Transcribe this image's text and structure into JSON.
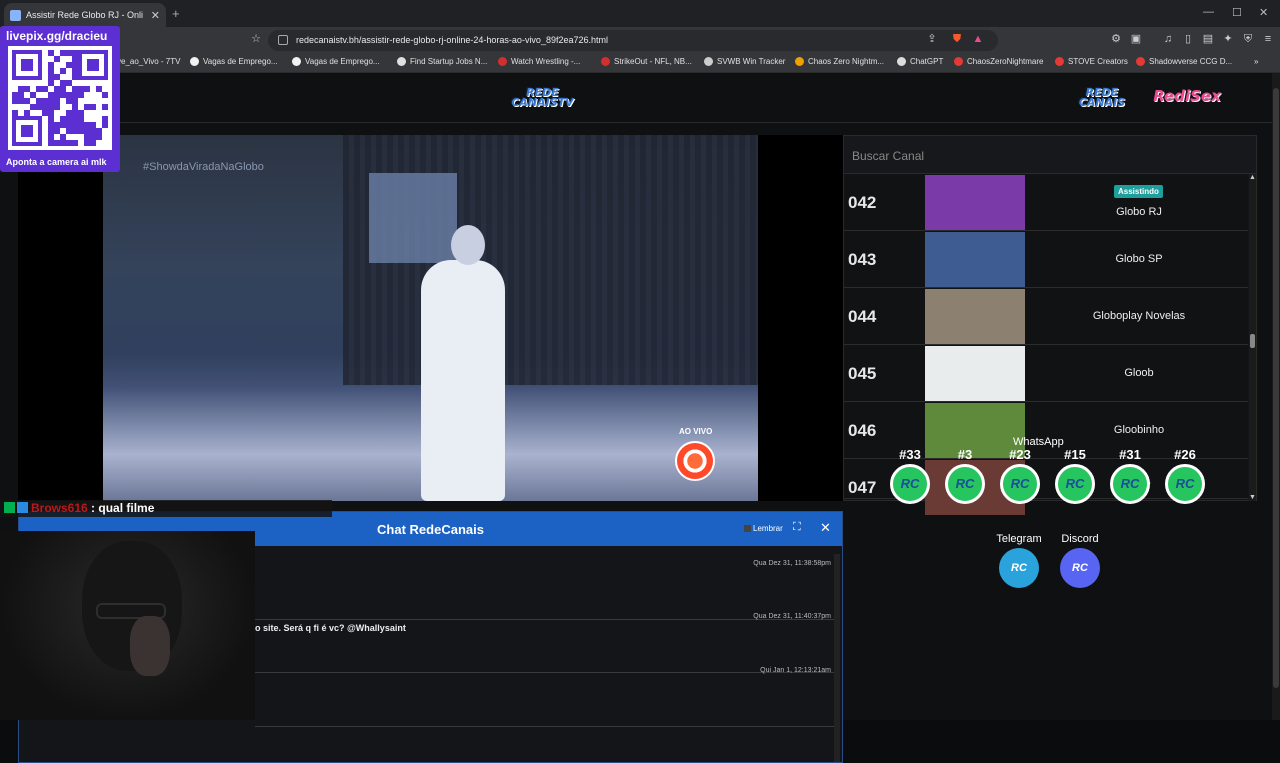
{
  "browser": {
    "tab_title": "Assistir Rede Globo RJ - Onli",
    "url": "redecanaistv.bh/assistir-rede-globo-rj-online-24-horas-ao-vivo_89f2ea726.html",
    "new_tab": "+",
    "bookmarks": [
      {
        "label": "ve_ao_Vivo - 7TV",
        "color": "#888888"
      },
      {
        "label": "Vagas de Emprego...",
        "color": "#f2f2f2"
      },
      {
        "label": "Vagas de Emprego...",
        "color": "#f2f2f2"
      },
      {
        "label": "Find Startup Jobs N...",
        "color": "#e0e0e0"
      },
      {
        "label": "Watch Wrestling -...",
        "color": "#d32f2f"
      },
      {
        "label": "StrikeOut - NFL, NB...",
        "color": "#d32f2f"
      },
      {
        "label": "SVWB Win Tracker",
        "color": "#cccccc"
      },
      {
        "label": "Chaos Zero Nightm...",
        "color": "#f0a000"
      },
      {
        "label": "ChatGPT",
        "color": "#dddddd"
      },
      {
        "label": "ChaosZeroNightmare",
        "color": "#e53935"
      },
      {
        "label": "STOVE Creators",
        "color": "#e53935"
      },
      {
        "label": "Shadowverse CCG D...",
        "color": "#e53935"
      }
    ]
  },
  "site": {
    "logo_main_line1": "REDE",
    "logo_main_line2": "CANAISTV",
    "logo_right1_line1": "REDE",
    "logo_right1_line2": "CANAIS",
    "logo_right2": "RediSex"
  },
  "player": {
    "hashtag": "#ShowdaViradaNaGlobo",
    "live_label": "AO VIVO"
  },
  "channels": {
    "search_placeholder": "Buscar Canal",
    "items": [
      {
        "number": "042",
        "name": "Globo RJ",
        "badge": "Assistindo",
        "thumb": "#7a3aa8"
      },
      {
        "number": "043",
        "name": "Globo SP",
        "badge": "",
        "thumb": "#3f5c92"
      },
      {
        "number": "044",
        "name": "Globoplay Novelas",
        "badge": "",
        "thumb": "#8c8170"
      },
      {
        "number": "045",
        "name": "Gloob",
        "badge": "",
        "thumb": "#e8eced"
      },
      {
        "number": "046",
        "name": "Gloobinho",
        "badge": "",
        "thumb": "#5f8a3c"
      },
      {
        "number": "047",
        "name": "GNT",
        "badge": "",
        "thumb": "#6a3a34"
      }
    ]
  },
  "overlay": {
    "qr_handle": "livepix.gg/dracieu",
    "qr_caption": "Aponta a camera ai mlk",
    "chat_user": "Brows616",
    "chat_text": " : qual filme"
  },
  "chat": {
    "title": "Chat RedeCanais",
    "remember_label": "Lembrar",
    "fullscreen_icon": "⛶",
    "close_icon": "✕",
    "messages": [
      {
        "timestamp": "Qua Dez 31, 11:38:58pm",
        "text": ""
      },
      {
        "timestamp": "Qua Dez 31, 11:40:37pm",
        "text": "o site. Será q fi é vc? @Whallysaint"
      },
      {
        "timestamp": "Qui Jan 1, 12:13:21am",
        "text": ""
      }
    ]
  },
  "contacts": {
    "whatsapp_title": "WhatsApp",
    "whatsapp_groups": [
      "#33",
      "#3",
      "#23",
      "#15",
      "#31",
      "#26"
    ],
    "icon_text": "RC",
    "telegram_label": "Telegram",
    "discord_label": "Discord",
    "whatsapp_color": "#26c560",
    "telegram_color": "#2aa3dd",
    "discord_color": "#5865f2"
  }
}
